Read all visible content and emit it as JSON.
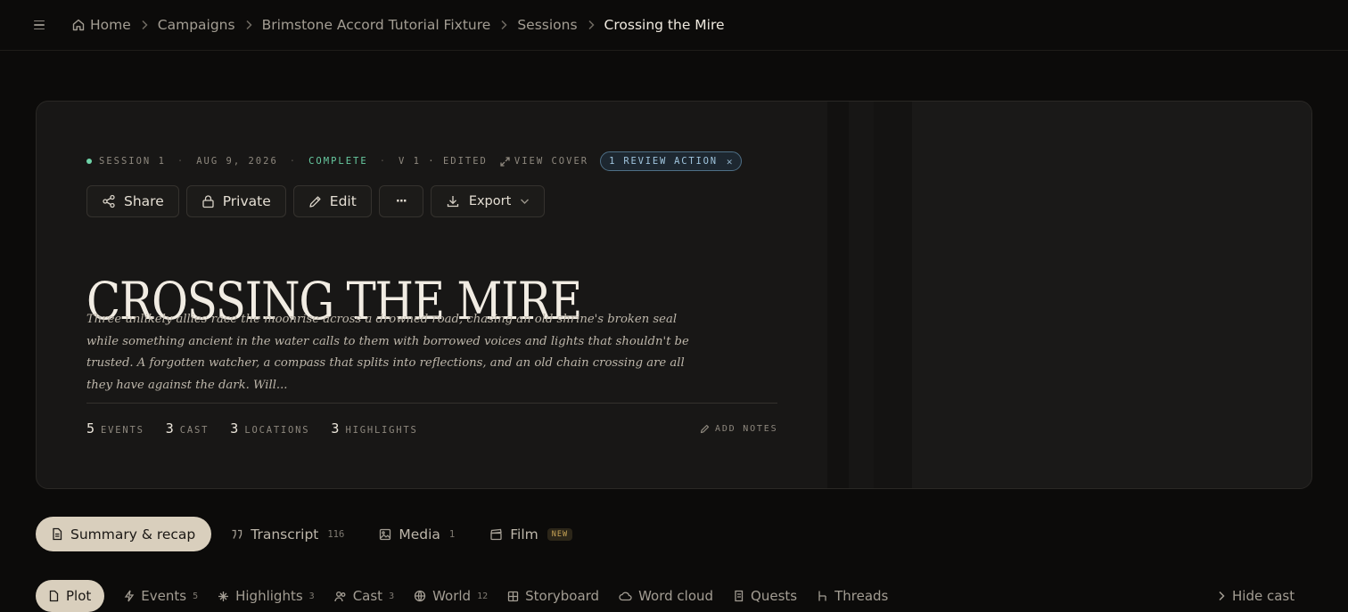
{
  "breadcrumb": {
    "items": [
      {
        "label": "Home"
      },
      {
        "label": "Campaigns"
      },
      {
        "label": "Brimstone Accord Tutorial Fixture"
      },
      {
        "label": "Sessions"
      },
      {
        "label": "Crossing the Mire"
      }
    ]
  },
  "session": {
    "number": "SESSION 1",
    "date": "AUG 9, 2026",
    "status": "COMPLETE",
    "version": "V 1 · EDITED",
    "view_cover": "VIEW COVER",
    "review_action": "1 REVIEW ACTION",
    "title": "CROSSING THE MIRE",
    "summary": "Three unlikely allies race the moonrise across a drowned road, chasing an old shrine's broken seal while something ancient in the water calls to them with borrowed voices and lights that shouldn't be trusted. A forgotten watcher, a compass that splits into reflections, and an old chain crossing are all they have against the dark. Will..."
  },
  "actions": {
    "share": "Share",
    "private": "Private",
    "edit": "Edit",
    "more": "···",
    "export": "Export"
  },
  "stats": [
    {
      "value": "5",
      "label": "EVENTS"
    },
    {
      "value": "3",
      "label": "CAST"
    },
    {
      "value": "3",
      "label": "LOCATIONS"
    },
    {
      "value": "3",
      "label": "HIGHLIGHTS"
    }
  ],
  "add_notes": "ADD NOTES",
  "tabs": [
    {
      "label": "Summary & recap",
      "count": ""
    },
    {
      "label": "Transcript",
      "count": "116"
    },
    {
      "label": "Media",
      "count": "1"
    },
    {
      "label": "Film",
      "badge": "NEW"
    }
  ],
  "subtabs": [
    {
      "label": "Plot",
      "count": ""
    },
    {
      "label": "Events",
      "count": "5"
    },
    {
      "label": "Highlights",
      "count": "3"
    },
    {
      "label": "Cast",
      "count": "3"
    },
    {
      "label": "World",
      "count": "12"
    },
    {
      "label": "Storyboard",
      "count": ""
    },
    {
      "label": "Word cloud",
      "count": ""
    },
    {
      "label": "Quests",
      "count": ""
    },
    {
      "label": "Threads",
      "count": ""
    }
  ],
  "hide_cast": "Hide cast",
  "colors": {
    "background": "#0c0b0a",
    "card": "#181716",
    "accent_active_tab": "#d9cfbd",
    "status_complete": "#67c9a0",
    "review_pill": "#9fc4dd"
  }
}
